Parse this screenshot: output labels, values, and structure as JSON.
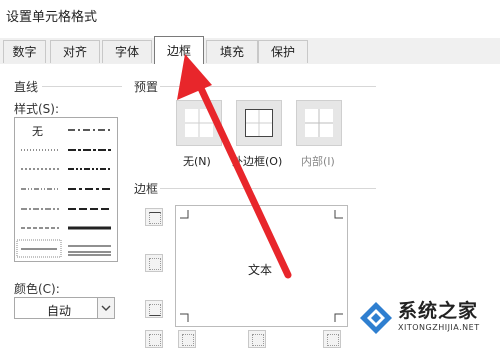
{
  "window": {
    "title": "设置单元格格式"
  },
  "tabs": [
    {
      "label": "数字"
    },
    {
      "label": "对齐"
    },
    {
      "label": "字体"
    },
    {
      "label": "边框",
      "active": true
    },
    {
      "label": "填充"
    },
    {
      "label": "保护"
    }
  ],
  "line": {
    "group_label": "直线",
    "style_label": "样式(S):",
    "none_label": "无",
    "color_label": "颜色(C):",
    "color_value": "自动"
  },
  "presets": {
    "group_label": "预置",
    "none": "无(N)",
    "outline": "外边框(O)",
    "inside": "内部(I)"
  },
  "border": {
    "group_label": "边框",
    "preview_text": "文本"
  },
  "watermark": {
    "brand": "系统之家",
    "url": "XITONGZHIJIA.NET"
  },
  "colors": {
    "annotation_arrow": "#e8262b"
  }
}
